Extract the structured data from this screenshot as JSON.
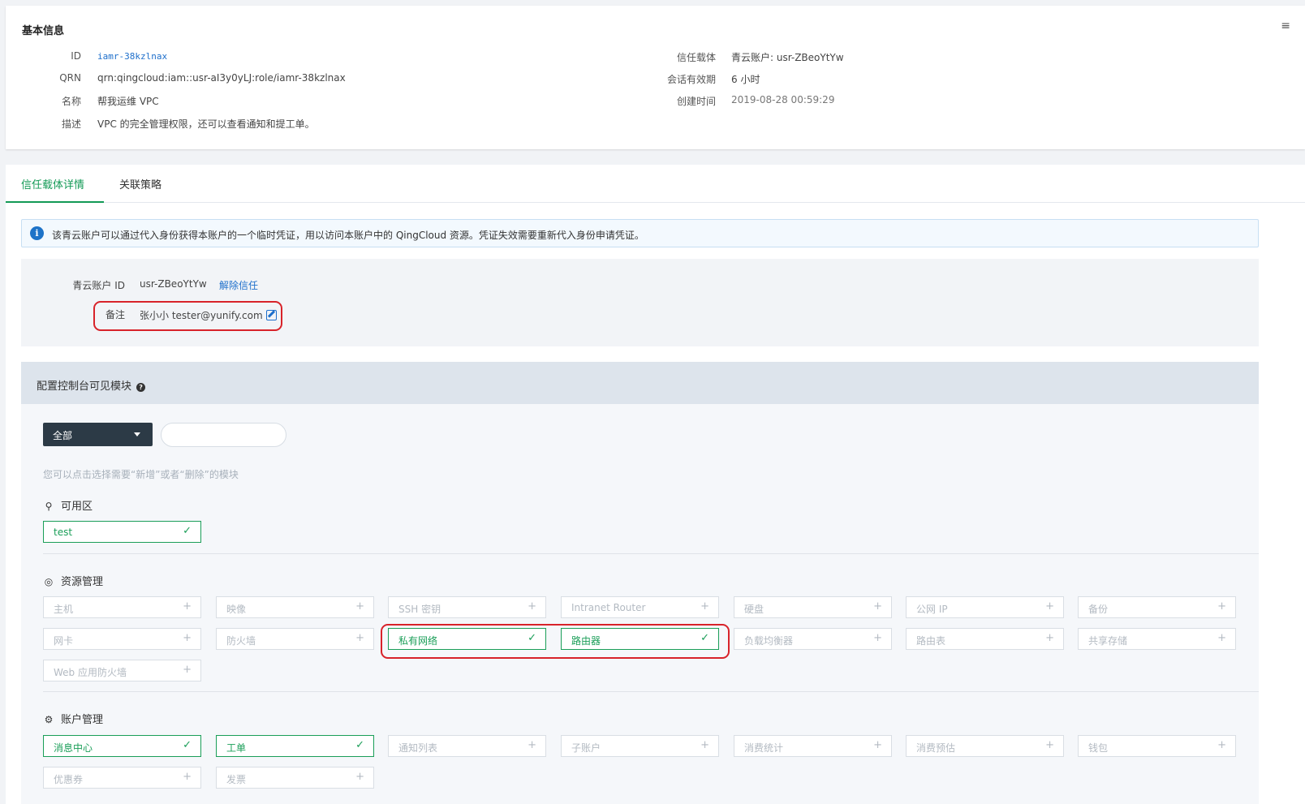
{
  "basic": {
    "title": "基本信息",
    "menu_icon": "≡",
    "id_label": "ID",
    "id_value": "iamr-38kzlnax",
    "qrn_label": "QRN",
    "qrn_value": "qrn:qingcloud:iam::usr-aI3y0yLJ:role/iamr-38kzlnax",
    "name_label": "名称",
    "name_value": "帮我运维 VPC",
    "desc_label": "描述",
    "desc_value": "VPC 的完全管理权限，还可以查看通知和提工单。",
    "trust_label": "信任载体",
    "trust_value": "青云账户: usr-ZBeoYtYw",
    "session_label": "会话有效期",
    "session_value": "6 小时",
    "created_label": "创建时间",
    "created_value": "2019-08-28 00:59:29"
  },
  "tabs": [
    {
      "label": "信任载体详情",
      "active": true
    },
    {
      "label": "关联策略",
      "active": false
    }
  ],
  "notice": {
    "icon": "i",
    "text": "该青云账户可以通过代入身份获得本账户的一个临时凭证，用以访问本账户中的 QingCloud 资源。凭证失效需要重新代入身份申请凭证。"
  },
  "trust": {
    "account_id_label": "青云账户 ID",
    "account_id_value": "usr-ZBeoYtYw",
    "revoke_link": "解除信任",
    "remark_label": "备注",
    "remark_value": "张小小 tester@yunify.com"
  },
  "modules": {
    "title": "配置控制台可见模块",
    "help_icon": "?",
    "select_value": "全部",
    "hint": "您可以点击选择需要“新增”或者“删除”的模块",
    "zone": {
      "title": "可用区",
      "items": [
        {
          "label": "test",
          "on": true
        }
      ]
    },
    "resource": {
      "title": "资源管理",
      "items": [
        {
          "label": "主机",
          "on": false
        },
        {
          "label": "映像",
          "on": false
        },
        {
          "label": "SSH 密钥",
          "on": false
        },
        {
          "label": "Intranet Router",
          "on": false
        },
        {
          "label": "硬盘",
          "on": false
        },
        {
          "label": "公网 IP",
          "on": false
        },
        {
          "label": "备份",
          "on": false
        },
        {
          "label": "网卡",
          "on": false
        },
        {
          "label": "防火墙",
          "on": false
        },
        {
          "label": "私有网络",
          "on": true
        },
        {
          "label": "路由器",
          "on": true
        },
        {
          "label": "负载均衡器",
          "on": false
        },
        {
          "label": "路由表",
          "on": false
        },
        {
          "label": "共享存储",
          "on": false
        },
        {
          "label": "Web 应用防火墙",
          "on": false
        }
      ]
    },
    "account": {
      "title": "账户管理",
      "items": [
        {
          "label": "消息中心",
          "on": true
        },
        {
          "label": "工单",
          "on": true
        },
        {
          "label": "通知列表",
          "on": false
        },
        {
          "label": "子账户",
          "on": false
        },
        {
          "label": "消费统计",
          "on": false
        },
        {
          "label": "消费预估",
          "on": false
        },
        {
          "label": "钱包",
          "on": false
        },
        {
          "label": "优惠券",
          "on": false
        },
        {
          "label": "发票",
          "on": false
        }
      ]
    },
    "check_mark": "✓",
    "plus_mark": "+"
  }
}
